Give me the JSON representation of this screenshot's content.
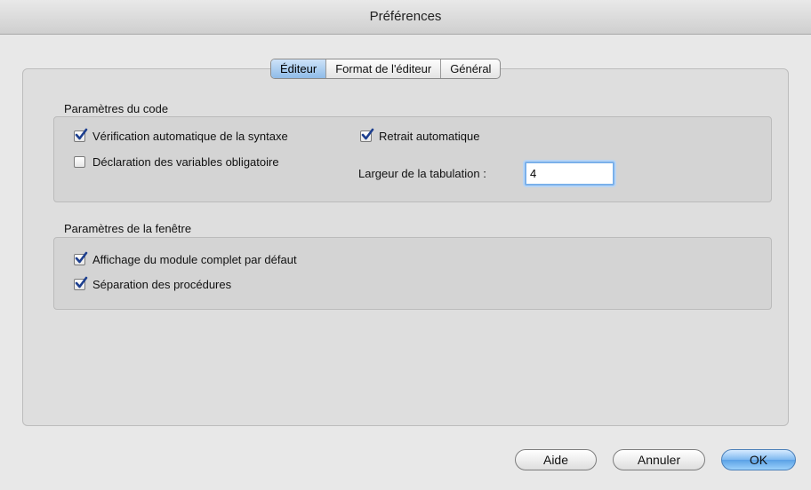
{
  "window": {
    "title": "Préférences"
  },
  "tabs": [
    {
      "label": "Éditeur",
      "active": true
    },
    {
      "label": "Format de l'éditeur",
      "active": false
    },
    {
      "label": "Général",
      "active": false
    }
  ],
  "code_settings": {
    "title": "Paramètres du code",
    "syntax_check": {
      "label": "Vérification automatique de la syntaxe",
      "checked": true
    },
    "require_var_declaration": {
      "label": "Déclaration des variables obligatoire",
      "checked": false
    },
    "auto_indent": {
      "label": "Retrait automatique",
      "checked": true
    },
    "tab_width": {
      "label": "Largeur de la tabulation :",
      "value": "4"
    }
  },
  "window_settings": {
    "title": "Paramètres de la fenêtre",
    "full_module_view": {
      "label": "Affichage du module complet par défaut",
      "checked": true
    },
    "procedure_separator": {
      "label": "Séparation des procédures",
      "checked": true
    }
  },
  "buttons": {
    "help": "Aide",
    "cancel": "Annuler",
    "ok": "OK"
  },
  "colors": {
    "accent": "#5aa1e6",
    "check": "#1d3f8f"
  }
}
